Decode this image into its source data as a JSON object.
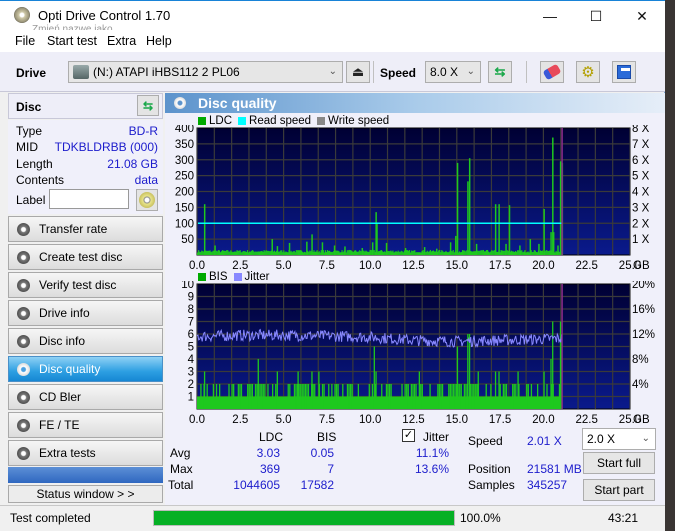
{
  "window": {
    "title": "Opti Drive Control 1.70",
    "ghost_text": "Zmień nazwę jako"
  },
  "menu": [
    "File",
    "Start test",
    "Extra",
    "Help"
  ],
  "toolbar": {
    "drive_label": "Drive",
    "drive_value": "(N:)   ATAPI iHBS112   2 PL06",
    "speed_label": "Speed",
    "speed_value": "8.0 X"
  },
  "disc": {
    "header": "Disc",
    "fields": [
      {
        "label": "Type",
        "value": "BD-R"
      },
      {
        "label": "MID",
        "value": "TDKBLDRBB (000)"
      },
      {
        "label": "Length",
        "value": "21.08 GB"
      },
      {
        "label": "Contents",
        "value": "data"
      }
    ],
    "label_field_label": "Label",
    "label_value": ""
  },
  "nav": [
    {
      "label": "Transfer rate",
      "active": false
    },
    {
      "label": "Create test disc",
      "active": false
    },
    {
      "label": "Verify test disc",
      "active": false
    },
    {
      "label": "Drive info",
      "active": false
    },
    {
      "label": "Disc info",
      "active": false
    },
    {
      "label": "Disc quality",
      "active": true
    },
    {
      "label": "CD Bler",
      "active": false
    },
    {
      "label": "FE / TE",
      "active": false
    },
    {
      "label": "Extra tests",
      "active": false
    }
  ],
  "status_window_label": "Status window > >",
  "panel_title": "Disc quality",
  "colors": {
    "ldc": "#00aa00",
    "read_speed": "#00ffff",
    "write_speed": "#888888",
    "bis": "#00aa00",
    "jitter": "#8888ff",
    "bar_fill": "#1ec81e",
    "plot_bg_top": "#000033",
    "plot_bg_bottom": "#0a1a8c",
    "end_marker": "#8a2a8a"
  },
  "chart_data": [
    {
      "type": "bar",
      "title": "LDC",
      "legend": [
        "LDC",
        "Read speed",
        "Write speed"
      ],
      "legend_position": "top-left",
      "x_unit": "GB",
      "xlim": [
        0,
        25
      ],
      "x_ticks": [
        "0.0",
        "2.5",
        "5.0",
        "7.5",
        "10.0",
        "12.5",
        "15.0",
        "17.5",
        "20.0",
        "22.5",
        "25.0"
      ],
      "ylim": [
        0,
        400
      ],
      "y_ticks": [
        "50",
        "100",
        "150",
        "200",
        "250",
        "300",
        "350",
        "400"
      ],
      "y2lim": [
        0,
        8
      ],
      "y2_ticks": [
        "1 X",
        "2 X",
        "3 X",
        "4 X",
        "5 X",
        "6 X",
        "7 X",
        "8 X"
      ],
      "grid": true,
      "end_position_gb": 21.08,
      "baseline_ldc": 8,
      "ldc_spikes": [
        {
          "x": 0.4,
          "y": 160
        },
        {
          "x": 1.0,
          "y": 30
        },
        {
          "x": 4.3,
          "y": 50
        },
        {
          "x": 4.6,
          "y": 28
        },
        {
          "x": 5.3,
          "y": 38
        },
        {
          "x": 6.3,
          "y": 42
        },
        {
          "x": 6.6,
          "y": 65
        },
        {
          "x": 7.2,
          "y": 40
        },
        {
          "x": 7.9,
          "y": 30
        },
        {
          "x": 8.5,
          "y": 27
        },
        {
          "x": 9.5,
          "y": 22
        },
        {
          "x": 10.1,
          "y": 40
        },
        {
          "x": 10.3,
          "y": 135
        },
        {
          "x": 10.35,
          "y": 100
        },
        {
          "x": 10.9,
          "y": 38
        },
        {
          "x": 12.0,
          "y": 22
        },
        {
          "x": 13.1,
          "y": 25
        },
        {
          "x": 13.8,
          "y": 20
        },
        {
          "x": 14.6,
          "y": 40
        },
        {
          "x": 14.9,
          "y": 60
        },
        {
          "x": 15.0,
          "y": 290
        },
        {
          "x": 15.6,
          "y": 232
        },
        {
          "x": 15.7,
          "y": 305
        },
        {
          "x": 16.1,
          "y": 35
        },
        {
          "x": 17.2,
          "y": 160
        },
        {
          "x": 17.4,
          "y": 160
        },
        {
          "x": 17.8,
          "y": 35
        },
        {
          "x": 18.0,
          "y": 157
        },
        {
          "x": 18.6,
          "y": 30
        },
        {
          "x": 19.2,
          "y": 50
        },
        {
          "x": 19.7,
          "y": 35
        },
        {
          "x": 20.0,
          "y": 145
        },
        {
          "x": 20.4,
          "y": 72
        },
        {
          "x": 20.5,
          "y": 370
        },
        {
          "x": 20.55,
          "y": 72
        },
        {
          "x": 20.8,
          "y": 30
        },
        {
          "x": 20.95,
          "y": 295
        },
        {
          "x": 21.05,
          "y": 290
        }
      ],
      "read_speed_x": 2.0
    },
    {
      "type": "bar",
      "title": "BIS / Jitter",
      "legend": [
        "BIS",
        "Jitter"
      ],
      "legend_position": "top-left",
      "x_unit": "GB",
      "xlim": [
        0,
        25
      ],
      "x_ticks": [
        "0.0",
        "2.5",
        "5.0",
        "7.5",
        "10.0",
        "12.5",
        "15.0",
        "17.5",
        "20.0",
        "22.5",
        "25.0"
      ],
      "ylim": [
        0,
        10
      ],
      "y_ticks": [
        "1",
        "2",
        "3",
        "4",
        "5",
        "6",
        "7",
        "8",
        "9",
        "10"
      ],
      "y2lim": [
        0,
        20
      ],
      "y2_ticks": [
        "4%",
        "8%",
        "12%",
        "16%",
        "20%"
      ],
      "grid": true,
      "end_position_gb": 21.08,
      "baseline_bis": 1,
      "bis_spikes": [
        {
          "x": 0.4,
          "y": 3
        },
        {
          "x": 3.5,
          "y": 4
        },
        {
          "x": 4.6,
          "y": 3
        },
        {
          "x": 5.8,
          "y": 3
        },
        {
          "x": 6.6,
          "y": 3
        },
        {
          "x": 7.0,
          "y": 3
        },
        {
          "x": 10.2,
          "y": 5
        },
        {
          "x": 10.3,
          "y": 3
        },
        {
          "x": 12.8,
          "y": 3
        },
        {
          "x": 15.0,
          "y": 5
        },
        {
          "x": 15.6,
          "y": 6
        },
        {
          "x": 15.7,
          "y": 6
        },
        {
          "x": 16.2,
          "y": 3
        },
        {
          "x": 17.2,
          "y": 3
        },
        {
          "x": 17.4,
          "y": 3
        },
        {
          "x": 18.5,
          "y": 3
        },
        {
          "x": 20.0,
          "y": 3
        },
        {
          "x": 20.4,
          "y": 4
        },
        {
          "x": 20.5,
          "y": 7
        },
        {
          "x": 20.95,
          "y": 7
        },
        {
          "x": 21.0,
          "y": 6
        }
      ],
      "jitter_avg_percent": 11.1,
      "jitter_trend": [
        {
          "x": 0.0,
          "y": 11.6
        },
        {
          "x": 2.5,
          "y": 11.8
        },
        {
          "x": 5.0,
          "y": 11.8
        },
        {
          "x": 7.5,
          "y": 11.7
        },
        {
          "x": 10.0,
          "y": 11.5
        },
        {
          "x": 12.5,
          "y": 11.0
        },
        {
          "x": 15.0,
          "y": 10.8
        },
        {
          "x": 17.5,
          "y": 11.0
        },
        {
          "x": 20.0,
          "y": 11.2
        },
        {
          "x": 21.0,
          "y": 11.3
        }
      ]
    }
  ],
  "stats": {
    "col_ldc": "LDC",
    "col_bis": "BIS",
    "jitter_checkbox_label": "Jitter",
    "jitter_checked": true,
    "rows": [
      {
        "label": "Avg",
        "ldc": "3.03",
        "bis": "0.05",
        "jitter": "11.1%"
      },
      {
        "label": "Max",
        "ldc": "369",
        "bis": "7",
        "jitter": "13.6%"
      },
      {
        "label": "Total",
        "ldc": "1044605",
        "bis": "17582",
        "jitter": ""
      }
    ],
    "speed_label": "Speed",
    "speed_value": "2.01 X",
    "position_label": "Position",
    "position_value": "21581 MB",
    "samples_label": "Samples",
    "samples_value": "345257",
    "test_speed_select": "2.0 X",
    "start_full_label": "Start full",
    "start_part_label": "Start part"
  },
  "statusbar": {
    "text": "Test completed",
    "progress_percent": 100.0,
    "progress_label": "100.0%",
    "elapsed": "43:21"
  }
}
